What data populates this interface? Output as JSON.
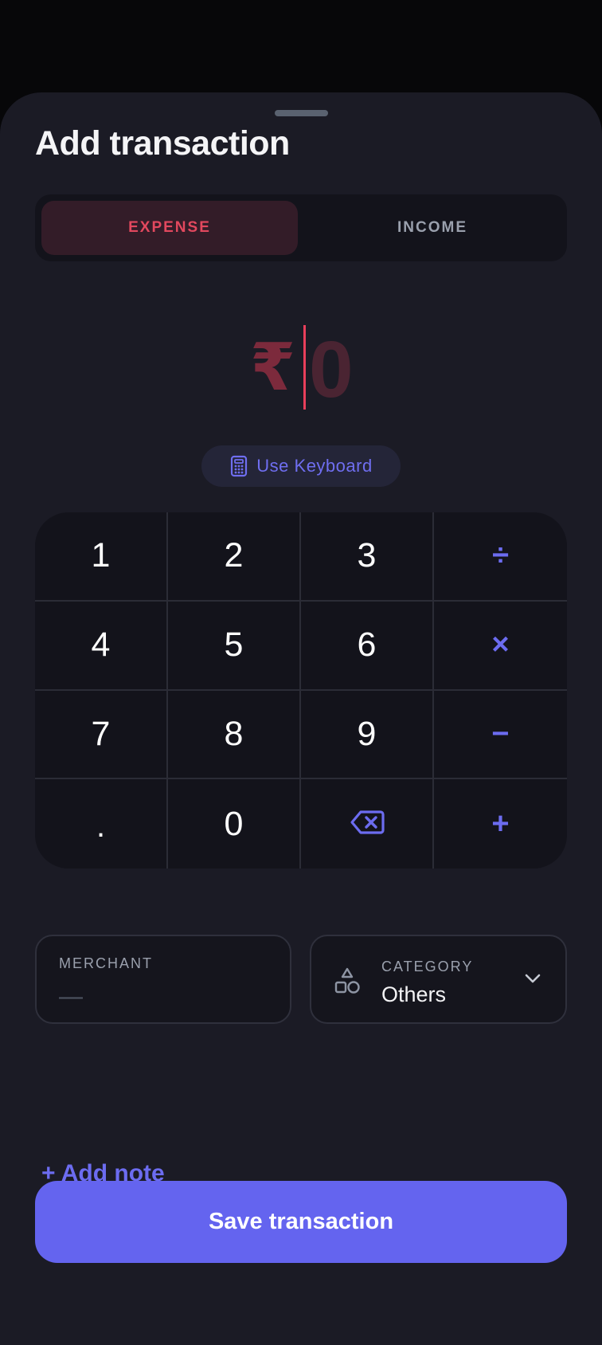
{
  "sheet": {
    "title": "Add transaction"
  },
  "type_toggle": {
    "options": [
      {
        "label": "EXPENSE",
        "selected": true
      },
      {
        "label": "INCOME",
        "selected": false
      }
    ]
  },
  "amount": {
    "currency": "₹",
    "value": "0"
  },
  "use_keyboard": {
    "label": "Use Keyboard",
    "icon": "calculator-icon"
  },
  "keypad": {
    "keys": [
      "1",
      "2",
      "3",
      "÷",
      "4",
      "5",
      "6",
      "×",
      "7",
      "8",
      "9",
      "−",
      ".",
      "0",
      "backspace-icon",
      "+"
    ]
  },
  "merchant": {
    "label": "MERCHANT",
    "placeholder": "—"
  },
  "category": {
    "label": "CATEGORY",
    "value": "Others",
    "icon": "shapes-icon",
    "dropdown_icon": "chevron-down-icon"
  },
  "add_note": {
    "label": "+ Add note"
  },
  "save_button": {
    "label": "Save transaction"
  },
  "colors": {
    "background": "#1b1b25",
    "accent": "#6464ef",
    "expense": "#e2485e"
  }
}
